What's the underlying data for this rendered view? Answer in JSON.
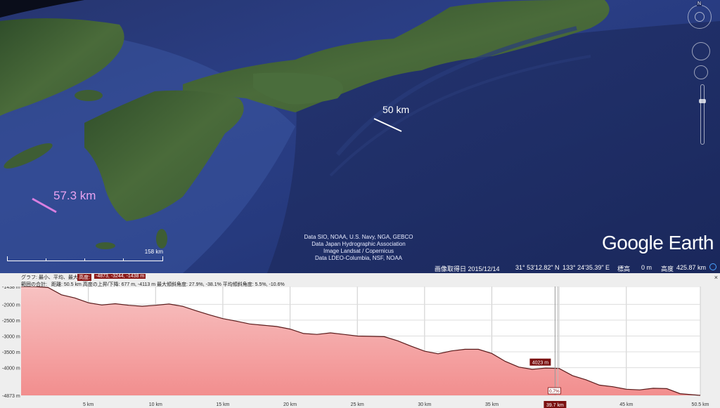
{
  "map": {
    "measure_labels": {
      "left": "57.3 km",
      "right": "50 km"
    },
    "attribution": [
      "Data SIO, NOAA, U.S. Navy, NGA, GEBCO",
      "Data Japan Hydrographic Association",
      "Image Landsat / Copernicus",
      "Data LDEO-Columbia, NSF, NOAA"
    ],
    "logo": {
      "google": "Google",
      "earth": "Earth"
    },
    "scale_label": "158 km",
    "compass_letter": "N"
  },
  "status": {
    "imagery_date": "画像取得日 2015/12/14",
    "lat": "31° 53'12.82\" N",
    "lon": "133° 24'35.39\" E",
    "elev_label": "標高",
    "elev_value": "0 m",
    "alt_label": "高度",
    "alt_value": "425.87 km"
  },
  "profile": {
    "header1": {
      "prefix": "グラフ: 最小、平均、最大",
      "elev_label": "高度:",
      "elev_values": "-4873, -3244, -1438 m"
    },
    "header2": {
      "prefix": "範囲の合計:",
      "text": "距離: 50.5 km  高度の上昇/下降: 677 m, -4113 m  最大傾斜角度: 27.9%, -38.1%  平均傾斜角度: 5.5%, -10.6%"
    },
    "close_icon": "×",
    "cursor_value": "4023 m",
    "cursor_slope": "0.7%",
    "cursor_distance": "39.7 km"
  },
  "chart_data": {
    "type": "area",
    "title": "",
    "xlabel": "",
    "ylabel": "",
    "xlim": [
      0,
      50.5
    ],
    "ylim": [
      -4873,
      -1438
    ],
    "y_tick_labels": [
      "-1438 m",
      "-2000 m",
      "-2500 m",
      "-3000 m",
      "-3500 m",
      "-4000 m",
      "-4873 m"
    ],
    "x_tick_labels": [
      "5 km",
      "10 km",
      "15 km",
      "20 km",
      "25 km",
      "30 km",
      "35 km",
      "40 km",
      "45 km",
      "50.5 km"
    ],
    "series": [
      {
        "x": [
          0,
          1,
          2,
          3,
          4,
          5,
          6,
          7,
          8,
          9,
          10,
          11,
          12,
          13,
          14,
          15,
          16,
          17,
          18,
          19,
          20,
          21,
          22,
          23,
          24,
          25,
          26,
          27,
          28,
          29,
          30,
          31,
          32,
          33,
          34,
          35,
          36,
          37,
          38,
          39,
          40,
          41,
          42,
          43,
          44,
          45,
          46,
          47,
          48,
          49,
          50.5
        ],
        "y": [
          -1438,
          -1440,
          -1470,
          -1700,
          -1800,
          -1950,
          -2020,
          -1980,
          -2030,
          -2060,
          -2030,
          -1990,
          -2060,
          -2200,
          -2330,
          -2450,
          -2530,
          -2620,
          -2660,
          -2700,
          -2780,
          -2920,
          -2950,
          -2900,
          -2950,
          -3000,
          -3010,
          -3020,
          -3150,
          -3320,
          -3480,
          -3560,
          -3470,
          -3420,
          -3420,
          -3550,
          -3800,
          -3980,
          -4050,
          -4010,
          -4023,
          -4250,
          -4380,
          -4550,
          -4600,
          -4680,
          -4700,
          -4650,
          -4660,
          -4820,
          -4873
        ]
      }
    ],
    "colors": {
      "fill": "#f4a6a6",
      "line": "#5a1a1a"
    }
  }
}
